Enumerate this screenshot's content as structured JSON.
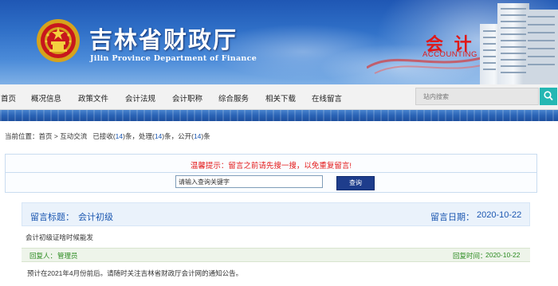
{
  "header": {
    "site_title": "吉林省财政厅",
    "site_subtitle": "Jilin Province Department of Finance",
    "brand_cn": "会 计 网",
    "brand_en": "ACCOUNTING",
    "emblem_icon": "national-emblem-icon",
    "building_image": "office-building-photo"
  },
  "nav": {
    "items": [
      {
        "label": "首页"
      },
      {
        "label": "概况信息"
      },
      {
        "label": "政策文件"
      },
      {
        "label": "会计法规"
      },
      {
        "label": "会计职称"
      },
      {
        "label": "综合服务"
      },
      {
        "label": "相关下载"
      },
      {
        "label": "在线留言"
      }
    ],
    "search_placeholder": "站内搜索",
    "search_icon": "search-icon"
  },
  "breadcrumb": {
    "prefix": "当前位置：",
    "home": "首页",
    "separator": " > ",
    "section": "互动交流",
    "received_label": "已接收(",
    "received_count": "14",
    "processed_label": ")条，处理(",
    "processed_count": "14",
    "public_label": ")条，公开(",
    "public_count": "14",
    "suffix": ")条"
  },
  "search_form": {
    "notice": "温馨提示：留言之前请先搜一搜，以免重复留言!",
    "keyword_value": "请输入查询关键字",
    "query_button": "查询"
  },
  "message": {
    "title_label": "留言标题：",
    "title": "会计初级",
    "date_label": "留言日期：",
    "date": "2020-10-22",
    "content": "会计初级证啥时候能发",
    "replier_label": "回复人：",
    "replier": "管理员",
    "reply_time_label": "回复时间：",
    "reply_time": "2020-10-22",
    "reply_content": "预计在2021年4月份前后。请随时关注吉林省财政厅会计网的通知公告。"
  },
  "colors": {
    "banner_blue": "#2f6fc7",
    "brand_red": "#e01818",
    "link_blue": "#1a56b0",
    "reply_green": "#2a8a1f",
    "search_teal": "#25b7b3",
    "query_navy": "#1e3d8c"
  }
}
